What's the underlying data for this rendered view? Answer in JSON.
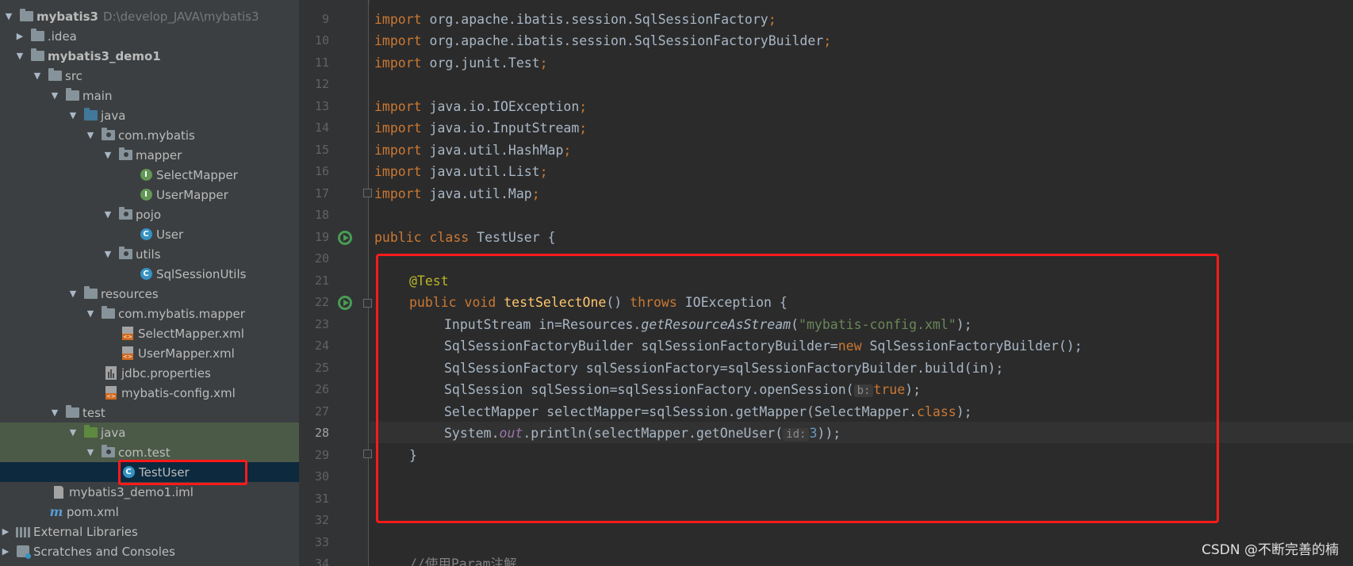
{
  "project_tree": {
    "root": {
      "label": "mybatis3",
      "path": "D:\\develop_JAVA\\mybatis3"
    },
    "items": {
      "idea": ".idea",
      "module": "mybatis3_demo1",
      "src": "src",
      "main": "main",
      "java_main": "java",
      "com_mybatis": "com.mybatis",
      "mapper": "mapper",
      "select_mapper": "SelectMapper",
      "user_mapper": "UserMapper",
      "pojo": "pojo",
      "user": "User",
      "utils": "utils",
      "sql_session_utils": "SqlSessionUtils",
      "resources": "resources",
      "com_mybatis_mapper": "com.mybatis.mapper",
      "select_mapper_xml": "SelectMapper.xml",
      "user_mapper_xml": "UserMapper.xml",
      "jdbc_properties": "jdbc.properties",
      "mybatis_config": "mybatis-config.xml",
      "test": "test",
      "java_test": "java",
      "com_test": "com.test",
      "test_user": "TestUser",
      "iml": "mybatis3_demo1.iml",
      "pom": "pom.xml",
      "external_libraries": "External Libraries",
      "scratches": "Scratches and Consoles"
    },
    "icon_letters": {
      "interface": "I",
      "class": "C",
      "maven": "m"
    }
  },
  "editor": {
    "line_numbers": [
      "9",
      "10",
      "11",
      "12",
      "13",
      "14",
      "15",
      "16",
      "17",
      "18",
      "19",
      "20",
      "21",
      "22",
      "23",
      "24",
      "25",
      "26",
      "27",
      "28",
      "29",
      "30",
      "31",
      "32",
      "33",
      "34"
    ],
    "current_line": "28",
    "code": {
      "l9_kw": "import",
      "l9_rest": " org.apache.ibatis.session.SqlSessionFactory",
      "l10_kw": "import",
      "l10_rest": " org.apache.ibatis.session.SqlSessionFactoryBuilder",
      "l11_kw": "import",
      "l11_rest": " org.junit.Test",
      "l13_kw": "import",
      "l13_rest": " java.io.IOException",
      "l14_kw": "import",
      "l14_rest": " java.io.InputStream",
      "l15_kw": "import",
      "l15_rest": " java.util.HashMap",
      "l16_kw": "import",
      "l16_rest": " java.util.List",
      "l17_kw": "import",
      "l17_rest": " java.util.Map",
      "semicolon": ";",
      "l19_kw": "public class",
      "l19_rest": " TestUser {",
      "l21_ann": "@Test",
      "l22_kw1": "public void",
      "l22_fn": "testSelectOne",
      "l22_mid": "() ",
      "l22_kw2": "throws",
      "l22_rest": " IOException {",
      "l23_a": "InputStream in=Resources.",
      "l23_method": "getResourceAsStream",
      "l23_b": "(",
      "l23_str": "\"mybatis-config.xml\"",
      "l23_c": ");",
      "l24_a": "SqlSessionFactoryBuilder sqlSessionFactoryBuilder=",
      "l24_kw": "new",
      "l24_b": " SqlSessionFactoryBuilder();",
      "l25_a": "SqlSessionFactory sqlSessionFactory=sqlSessionFactoryBuilder.build(in);",
      "l26_a": "SqlSession sqlSession=sqlSessionFactory.openSession(",
      "l26_hint": "b:",
      "l26_kw": "true",
      "l26_b": ");",
      "l27_a": "SelectMapper selectMapper=sqlSession.getMapper(SelectMapper.",
      "l27_kw": "class",
      "l27_b": ");",
      "l28_a": "System.",
      "l28_out": "out",
      "l28_b": ".println(selectMapper.getOneUser(",
      "l28_hint": "id:",
      "l28_num": "3",
      "l28_c": "));",
      "l29": "}",
      "l34_cmt": "//使用Param注解"
    }
  },
  "watermark": "CSDN @不断完善的楠"
}
